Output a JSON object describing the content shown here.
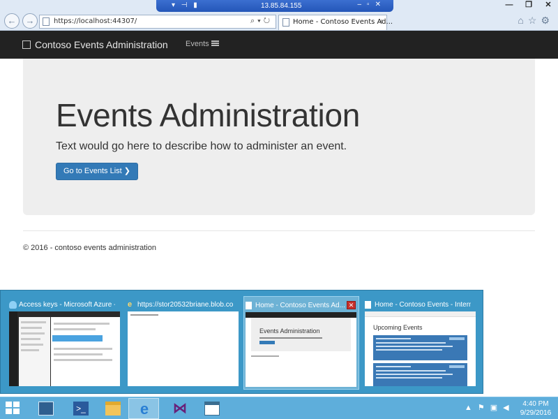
{
  "remote_bar": {
    "ip": "13.85.84.155"
  },
  "browser": {
    "address": "https://localhost:44307/",
    "tab_title": "Home - Contoso Events Ad...",
    "tab_close": "×"
  },
  "navbar": {
    "brand": "Contoso Events Administration",
    "events_link": "Events"
  },
  "jumbotron": {
    "title": "Events Administration",
    "description": "Text would go here to describe how to administer an event.",
    "button_label": "Go to Events List ❯"
  },
  "footer": {
    "text": "© 2016 - contoso events administration"
  },
  "thumbnails": [
    {
      "title": "Access keys - Microsoft Azure - ..."
    },
    {
      "title": "https://stor20532briane.blob.co..."
    },
    {
      "title": "Home - Contoso Events Ad..."
    },
    {
      "title": "Home - Contoso Events - Intern..."
    }
  ],
  "thumbnail_previews": {
    "admin_title": "Events Administration",
    "upcoming_title": "Upcoming Events"
  },
  "clock": {
    "time": "4:40 PM",
    "date": "9/29/2016"
  },
  "colors": {
    "primary_button": "#337ab7",
    "navbar": "#222222",
    "jumbotron": "#eeeeee",
    "taskbar": "#5eaedb"
  }
}
